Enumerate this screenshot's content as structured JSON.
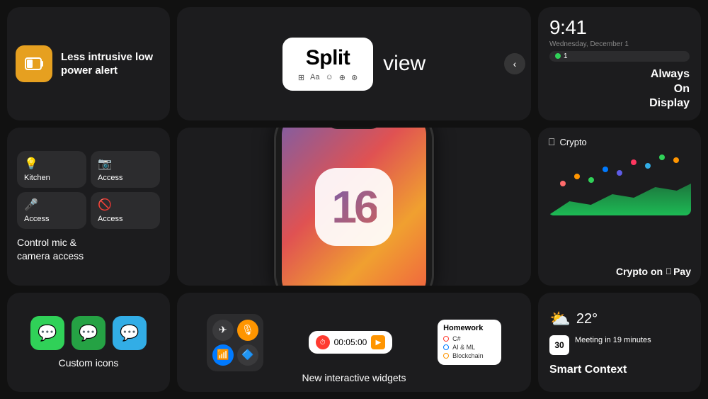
{
  "cards": {
    "lowPower": {
      "title": "Less intrusive low power alert",
      "iconColor": "#e6a020",
      "iconLabel": "battery-icon"
    },
    "splitView": {
      "splitLabel": "Split",
      "viewLabel": "view",
      "icons": [
        "⊞",
        "Aa",
        "☺",
        "⊕",
        "⊛"
      ]
    },
    "aod": {
      "time": "9:41",
      "date": "Wednesday, December 1",
      "badge": "1",
      "label": "Always\nOn\nDisplay"
    },
    "controlCamera": {
      "items": [
        {
          "icon": "💡",
          "label": "Kitchen"
        },
        {
          "icon": "📷",
          "label": "Access"
        },
        {
          "icon": "🎤",
          "label": "Access"
        },
        {
          "icon": "🚫",
          "label": "Access"
        }
      ],
      "description": "Control mic &\ncamera access"
    },
    "ios16": {
      "number": "16"
    },
    "crypto": {
      "appName": "Crypto",
      "label": "Crypto on",
      "sublabel": " Pay"
    },
    "customIcons": {
      "label": "Custom icons"
    },
    "widgets": {
      "timerValue": "00:05:00",
      "homeworkTitle": "Homework",
      "homeworkItems": [
        "C#",
        "AI & ML",
        "Blockchain"
      ],
      "label": "New interactive widgets"
    },
    "smartContext": {
      "temp": "22°",
      "calDate": "30",
      "meetingText": "Meeting in 19 minutes",
      "label": "Smart Context"
    }
  }
}
